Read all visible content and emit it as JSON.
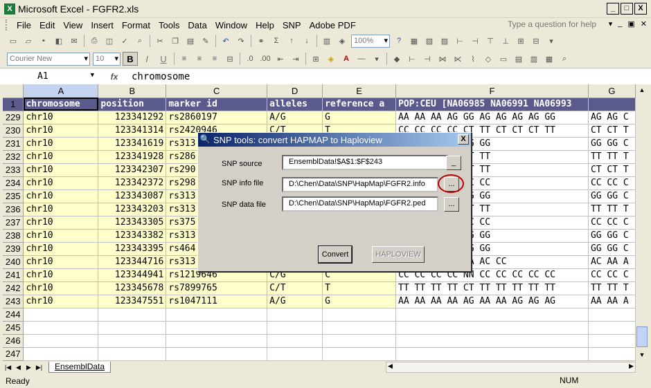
{
  "window": {
    "title": "Microsoft Excel - FGFR2.xls",
    "buttons": [
      "_",
      "□",
      "X"
    ]
  },
  "menubar": {
    "items": [
      "File",
      "Edit",
      "View",
      "Insert",
      "Format",
      "Tools",
      "Data",
      "Window",
      "Help",
      "SNP",
      "Adobe PDF"
    ],
    "help_placeholder": "Type a question for help"
  },
  "toolbar": {
    "zoom": "100%",
    "font": "Courier New",
    "size": "10",
    "bold": "B",
    "italic": "I",
    "underline": "U"
  },
  "formula_bar": {
    "namebox": "A1",
    "fx": "fx",
    "content": "chromosome"
  },
  "columns": [
    "A",
    "B",
    "C",
    "D",
    "E",
    "F",
    "G"
  ],
  "header_row": {
    "row_num": "1",
    "cells": [
      "chromosome",
      "position",
      "marker id",
      "alleles",
      "reference a",
      "POP:CEU [NA06985 NA06991 NA06993",
      ""
    ]
  },
  "rows": [
    {
      "n": "229",
      "a": "chr10",
      "b": "123341292",
      "c": "rs2860197",
      "d": "A/G",
      "e": "G",
      "f": "AA AA AA AG GG AG AG AG AG GG",
      "g": "AG AG C"
    },
    {
      "n": "230",
      "a": "chr10",
      "b": "123341314",
      "c": "rs2420946",
      "d": "C/T",
      "e": "T",
      "f": "CC CC CC CC CT TT CT CT CT TT",
      "g": "CT CT T"
    },
    {
      "n": "231",
      "a": "chr10",
      "b": "123341619",
      "c": "rs313",
      "d": "",
      "e": "",
      "f": "GG GG GG GG GG GG",
      "g": "GG GG C"
    },
    {
      "n": "232",
      "a": "chr10",
      "b": "123341928",
      "c": "rs286",
      "d": "",
      "e": "",
      "f": "TT TT TT TT TT TT",
      "g": "TT TT T"
    },
    {
      "n": "233",
      "a": "chr10",
      "b": "123342307",
      "c": "rs290",
      "d": "",
      "e": "",
      "f": "CT CT CT CT CT TT",
      "g": "CT CT T"
    },
    {
      "n": "234",
      "a": "chr10",
      "b": "123342372",
      "c": "rs298",
      "d": "",
      "e": "",
      "f": "CC CC CC CC CC CC",
      "g": "CC CC C"
    },
    {
      "n": "235",
      "a": "chr10",
      "b": "123343087",
      "c": "rs313",
      "d": "",
      "e": "",
      "f": "GG GG GG GG GG GG",
      "g": "GG GG C"
    },
    {
      "n": "236",
      "a": "chr10",
      "b": "123343203",
      "c": "rs313",
      "d": "",
      "e": "",
      "f": "TT TT TT TT TT TT",
      "g": "TT TT T"
    },
    {
      "n": "237",
      "a": "chr10",
      "b": "123343305",
      "c": "rs375",
      "d": "",
      "e": "",
      "f": "CC CC CC CC CC CC",
      "g": "CC CC C"
    },
    {
      "n": "238",
      "a": "chr10",
      "b": "123343382",
      "c": "rs313",
      "d": "",
      "e": "",
      "f": "GG GG GG GG GG GG",
      "g": "GG GG C"
    },
    {
      "n": "239",
      "a": "chr10",
      "b": "123343395",
      "c": "rs464",
      "d": "",
      "e": "",
      "f": "GG GG GG GG GG GG",
      "g": "GG GG C"
    },
    {
      "n": "240",
      "a": "chr10",
      "b": "123344716",
      "c": "rs313",
      "d": "",
      "e": "",
      "f": "AA CC AC AA AA AC CC",
      "g": "AC AA A"
    },
    {
      "n": "241",
      "a": "chr10",
      "b": "123344941",
      "c": "rs1219646",
      "d": "C/G",
      "e": "C",
      "f": "CC CC CC CC NN CC CC CC CC CC",
      "g": "CC CC C"
    },
    {
      "n": "242",
      "a": "chr10",
      "b": "123345678",
      "c": "rs7899765",
      "d": "C/T",
      "e": "T",
      "f": "TT TT TT TT CT TT TT TT TT TT",
      "g": "TT TT T"
    },
    {
      "n": "243",
      "a": "chr10",
      "b": "123347551",
      "c": "rs1047111",
      "d": "A/G",
      "e": "G",
      "f": "AA AA AA AA AG AA AA AG AG AG",
      "g": "AA AA A"
    },
    {
      "n": "244",
      "a": "",
      "b": "",
      "c": "",
      "d": "",
      "e": "",
      "f": "",
      "g": ""
    },
    {
      "n": "245",
      "a": "",
      "b": "",
      "c": "",
      "d": "",
      "e": "",
      "f": "",
      "g": ""
    },
    {
      "n": "246",
      "a": "",
      "b": "",
      "c": "",
      "d": "",
      "e": "",
      "f": "",
      "g": ""
    },
    {
      "n": "247",
      "a": "",
      "b": "",
      "c": "",
      "d": "",
      "e": "",
      "f": "",
      "g": ""
    }
  ],
  "dialog": {
    "title": "SNP tools: convert HAPMAP to Haploview",
    "close": "X",
    "snp_source_label": "SNP source",
    "snp_source_value": "EnsemblData!$A$1:$F$243",
    "snp_source_btn": "_",
    "info_file_label": "SNP info file",
    "info_file_value": "D:\\Chen\\Data\\SNP\\HapMap\\FGFR2.info",
    "info_browse": "...",
    "data_file_label": "SNP data file",
    "data_file_value": "D:\\Chen\\Data\\SNP\\HapMap\\FGFR2.ped",
    "data_browse": "...",
    "convert_btn": "Convert",
    "haploview_btn": "HAPLOVIEW"
  },
  "sheet_tab": "EnsemblData",
  "status": {
    "left": "Ready",
    "num": "NUM"
  },
  "colors": {
    "header_bg": "#5a5a8c",
    "highlight_yellow": "#ffffcc",
    "annotation_red": "#c00000"
  }
}
